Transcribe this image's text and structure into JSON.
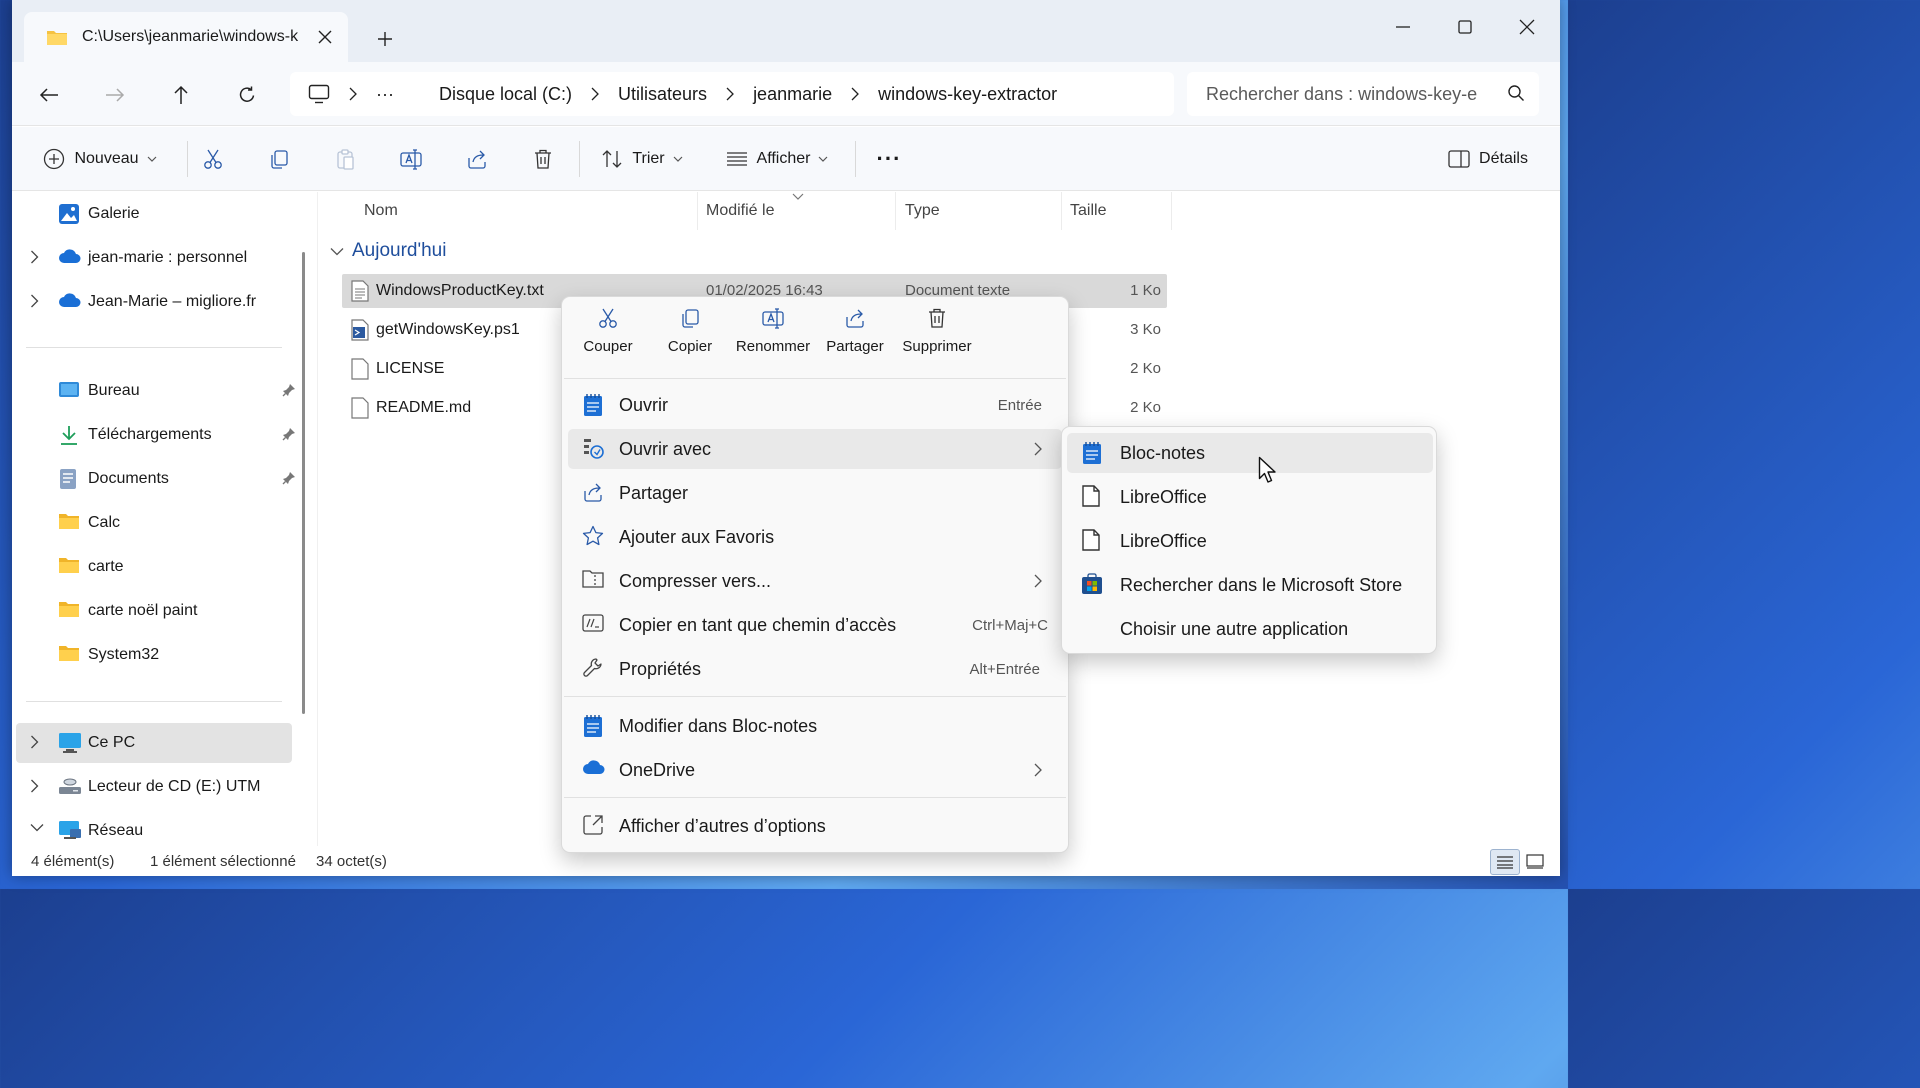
{
  "window": {
    "tab_title": "C:\\Users\\jeanmarie\\windows-k",
    "tab_close": "✕",
    "new_tab": "+",
    "controls": {
      "minimize": "minimize-icon",
      "maximize": "maximize-icon",
      "close": "close-icon"
    }
  },
  "address": {
    "more": "···",
    "crumbs": [
      "Disque local (C:)",
      "Utilisateurs",
      "jeanmarie",
      "windows-key-extractor"
    ],
    "search_placeholder": "Rechercher dans : windows-key-e"
  },
  "toolbar": {
    "new_label": "Nouveau",
    "sort_label": "Trier",
    "view_label": "Afficher",
    "more": "···",
    "details_label": "Détails"
  },
  "nav": {
    "items": [
      {
        "label": "Galerie",
        "icon": "gallery-icon"
      },
      {
        "label": "jean-marie : personnel",
        "icon": "cloud-icon"
      },
      {
        "label": "Jean-Marie – migliore.fr",
        "icon": "cloud-icon"
      },
      {
        "label": "Bureau",
        "icon": "desktop-icon"
      },
      {
        "label": "Téléchargements",
        "icon": "download-icon"
      },
      {
        "label": "Documents",
        "icon": "documents-icon"
      },
      {
        "label": "Calc",
        "icon": "folder-icon"
      },
      {
        "label": "carte",
        "icon": "folder-icon"
      },
      {
        "label": "carte noël paint",
        "icon": "folder-icon"
      },
      {
        "label": "System32",
        "icon": "folder-icon"
      },
      {
        "label": "Ce PC",
        "icon": "pc-icon"
      },
      {
        "label": "Lecteur de CD (E:) UTM",
        "icon": "cd-drive-icon"
      },
      {
        "label": "Réseau",
        "icon": "network-icon"
      }
    ]
  },
  "columns": {
    "name": "Nom",
    "modified": "Modifié le",
    "type": "Type",
    "size": "Taille"
  },
  "group_label": "Aujourd'hui",
  "files": [
    {
      "name": "WindowsProductKey.txt",
      "modified": "01/02/2025 16:43",
      "type": "Document texte",
      "size": "1 Ko"
    },
    {
      "name": "getWindowsKey.ps1",
      "modified": "",
      "type": "",
      "size": "3 Ko"
    },
    {
      "name": "LICENSE",
      "modified": "",
      "type": "",
      "size": "2 Ko"
    },
    {
      "name": "README.md",
      "modified": "",
      "type": "",
      "size": "2 Ko"
    }
  ],
  "status": {
    "count": "4 élément(s)",
    "selected": "1 élément sélectionné",
    "bytes": "34 octet(s)"
  },
  "context_menu": {
    "quick_actions": [
      "Couper",
      "Copier",
      "Renommer",
      "Partager",
      "Supprimer"
    ],
    "items": [
      {
        "label": "Ouvrir",
        "shortcut": "Entrée"
      },
      {
        "label": "Ouvrir avec"
      },
      {
        "label": "Partager"
      },
      {
        "label": "Ajouter aux Favoris"
      },
      {
        "label": "Compresser vers..."
      },
      {
        "label": "Copier en tant que chemin d’accès",
        "shortcut": "Ctrl+Maj+C"
      },
      {
        "label": "Propriétés",
        "shortcut": "Alt+Entrée"
      },
      {
        "label": "Modifier dans Bloc-notes"
      },
      {
        "label": "OneDrive"
      },
      {
        "label": "Afficher d’autres d’options"
      }
    ]
  },
  "submenu": {
    "items": [
      "Bloc-notes",
      "LibreOffice",
      "LibreOffice",
      "Rechercher dans le Microsoft Store",
      "Choisir une autre application"
    ]
  },
  "colors": {
    "accent": "#0067c0",
    "folder": "#f5c242",
    "group_text": "#1f4e9c",
    "selection": "#d9d9d9"
  }
}
